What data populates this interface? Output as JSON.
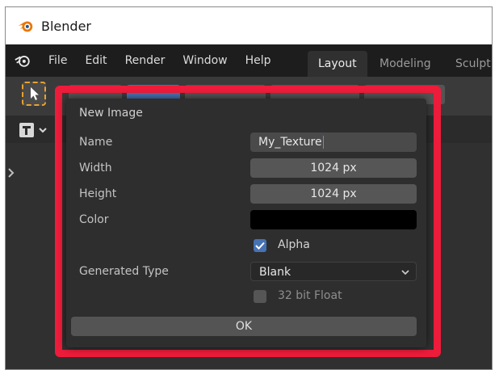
{
  "app": {
    "title": "Blender"
  },
  "menu": {
    "items": [
      "File",
      "Edit",
      "Render",
      "Window",
      "Help"
    ]
  },
  "workspace_tabs": [
    {
      "label": "Layout",
      "active": true
    },
    {
      "label": "Modeling",
      "active": false
    },
    {
      "label": "Sculpt",
      "active": false
    }
  ],
  "dialog": {
    "title": "New Image",
    "name_label": "Name",
    "name_value": "My_Texture",
    "width_label": "Width",
    "width_value": "1024 px",
    "height_label": "Height",
    "height_value": "1024 px",
    "color_label": "Color",
    "color_value": "#000000",
    "alpha_label": "Alpha",
    "alpha_checked": true,
    "generated_type_label": "Generated Type",
    "generated_type_value": "Blank",
    "float_label": "32 bit Float",
    "float_checked": false,
    "ok_label": "OK"
  },
  "colors": {
    "highlight": "#ed1c3a",
    "accent": "#4772b3",
    "tool_active": "#e7a32f"
  }
}
